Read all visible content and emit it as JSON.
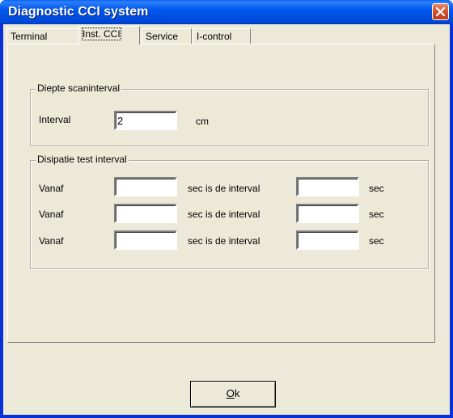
{
  "window": {
    "title": "Diagnostic CCI system"
  },
  "tabs": [
    {
      "label": "Terminal",
      "selected": false
    },
    {
      "label": "Inst. CCI",
      "selected": true
    },
    {
      "label": "Service",
      "selected": false
    },
    {
      "label": "I-control",
      "selected": false
    }
  ],
  "scan_group": {
    "legend": "Diepte scaninterval",
    "interval_label": "Interval",
    "interval_value": "2",
    "unit": "cm"
  },
  "dissipation_group": {
    "legend": "Disipatie test interval",
    "rows": [
      {
        "from_label": "Vanaf",
        "from_value": "",
        "middle_label": "sec is de interval",
        "to_value": "",
        "unit": "sec"
      },
      {
        "from_label": "Vanaf",
        "from_value": "",
        "middle_label": "sec is de interval",
        "to_value": "",
        "unit": "sec"
      },
      {
        "from_label": "Vanaf",
        "from_value": "",
        "middle_label": "sec is de interval",
        "to_value": "",
        "unit": "sec"
      }
    ]
  },
  "buttons": {
    "ok_mnemonic": "O",
    "ok_rest": "k"
  }
}
